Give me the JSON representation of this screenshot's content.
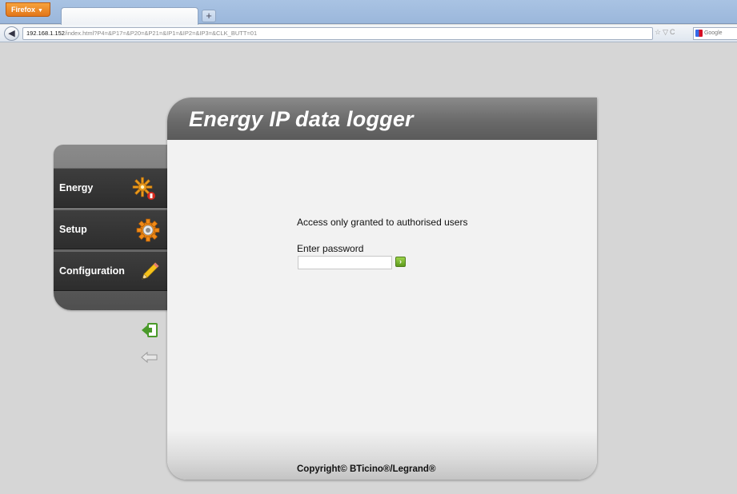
{
  "browser": {
    "menu_button": "Firefox",
    "new_tab": "+",
    "url_host": "192.168.1.152",
    "url_path": "/index.html?P4=&P17=&P20=&P21=&IP1=&IP2=&IP3=&CLK_BUTT=01",
    "search_placeholder": "Google"
  },
  "sidebar": {
    "items": [
      {
        "label": "Energy",
        "icon": "energy-gear-icon"
      },
      {
        "label": "Setup",
        "icon": "gear-icon"
      },
      {
        "label": "Configuration",
        "icon": "pencil-icon"
      }
    ]
  },
  "main": {
    "title": "Energy IP data logger",
    "access_message": "Access only granted to authorised users",
    "password_label": "Enter password",
    "password_value": "",
    "copyright": "Copyright© BTicino®/Legrand®"
  },
  "colors": {
    "header": "#6a6a6a",
    "panel": "#f2f2f2",
    "page_bg": "#d6d6d6",
    "go_button": "#6fb02a"
  }
}
